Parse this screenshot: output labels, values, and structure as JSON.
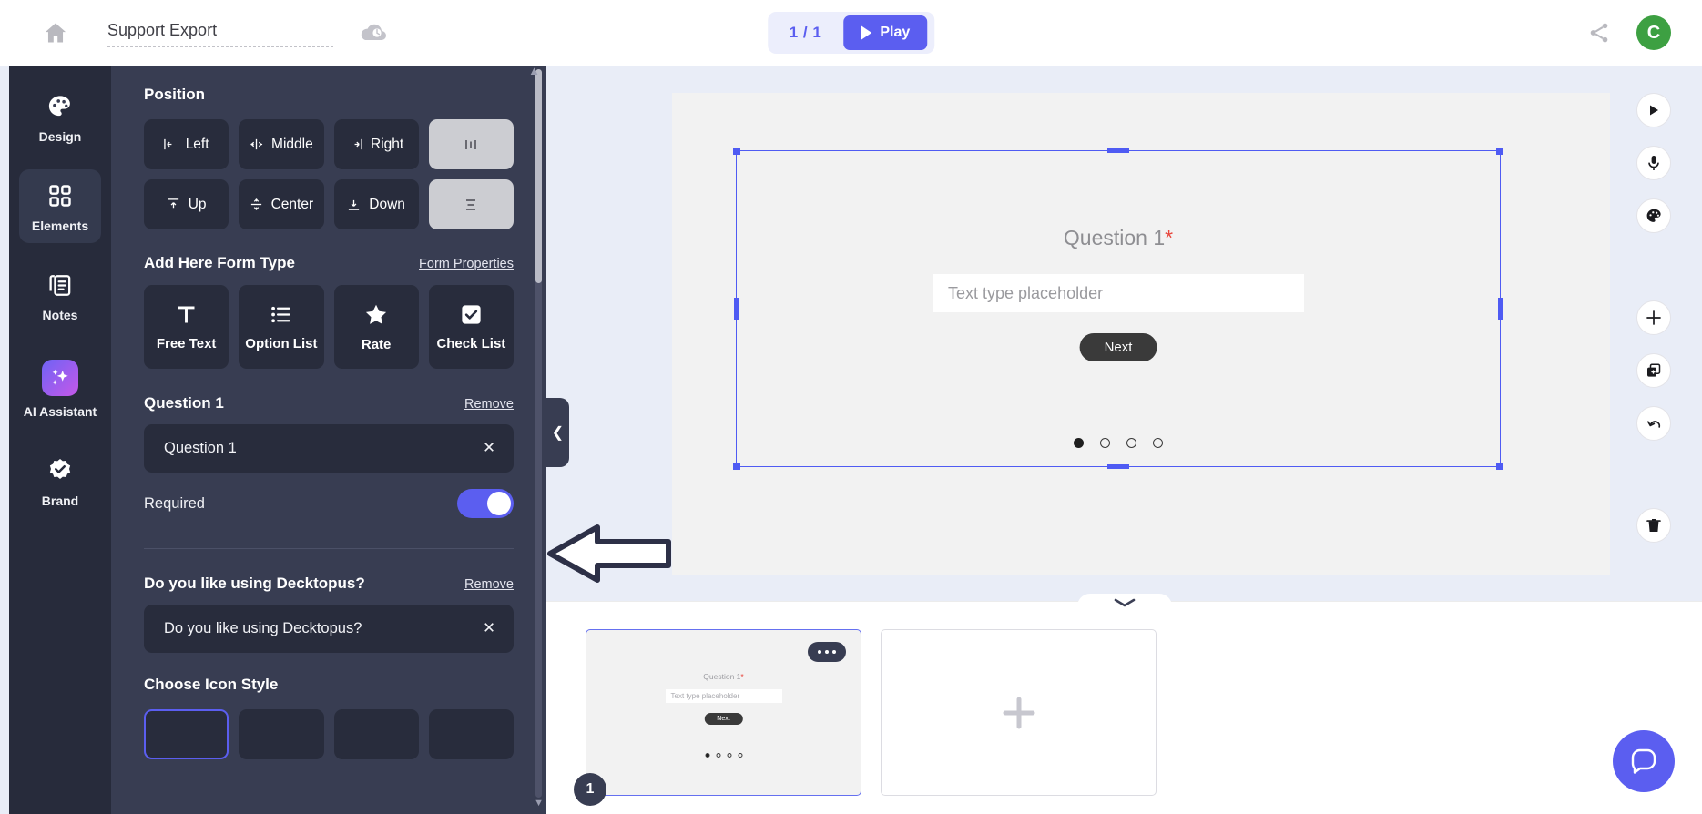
{
  "topbar": {
    "home_icon": "home-icon",
    "doc_title": "Support Export",
    "doc_title_placeholder": "Untitled",
    "cloud_icon": "cloud-clock-icon",
    "page_count": "1 / 1",
    "play_label": "Play",
    "share_icon": "share-icon",
    "avatar_initial": "C"
  },
  "rail": {
    "items": [
      {
        "label": "Design",
        "icon": "palette-icon",
        "active": false
      },
      {
        "label": "Elements",
        "icon": "grid-icon",
        "active": true
      },
      {
        "label": "Notes",
        "icon": "notes-icon",
        "active": false
      },
      {
        "label": "AI Assistant",
        "icon": "sparkle-icon",
        "active": false
      },
      {
        "label": "Brand",
        "icon": "badge-check-icon",
        "active": false
      }
    ]
  },
  "panel": {
    "position": {
      "title": "Position",
      "buttons": [
        {
          "label": "Left",
          "icon": "align-left-icon"
        },
        {
          "label": "Middle",
          "icon": "align-center-horizontal-icon"
        },
        {
          "label": "Right",
          "icon": "align-right-icon"
        },
        {
          "label": "",
          "icon": "distribute-horizontal-icon"
        },
        {
          "label": "Up",
          "icon": "align-top-icon"
        },
        {
          "label": "Center",
          "icon": "align-center-vertical-icon"
        },
        {
          "label": "Down",
          "icon": "align-bottom-icon"
        },
        {
          "label": "",
          "icon": "distribute-vertical-icon"
        }
      ]
    },
    "form_type": {
      "title": "Add Here Form Type",
      "properties_link": "Form Properties",
      "buttons": [
        {
          "label": "Free Text",
          "icon": "text-t-icon"
        },
        {
          "label": "Option List",
          "icon": "bullet-list-icon"
        },
        {
          "label": "Rate",
          "icon": "star-icon"
        },
        {
          "label": "Check List",
          "icon": "checkbox-icon"
        }
      ]
    },
    "question_1": {
      "title": "Question 1",
      "remove_label": "Remove",
      "input_value": "Question 1",
      "clear_icon": "close-icon",
      "required_label": "Required",
      "required_on": true
    },
    "question_2": {
      "title": "Do you like using Decktopus?",
      "remove_label": "Remove",
      "input_value": "Do you like using Decktopus?",
      "clear_icon": "close-icon"
    },
    "icon_style": {
      "title": "Choose Icon Style",
      "options": [
        "style-1",
        "style-2",
        "style-3",
        "style-4"
      ],
      "selected_index": 0
    },
    "collapse_chevron": "chevron-left-icon"
  },
  "canvas": {
    "question_label": "Question 1",
    "required_star": "*",
    "input_placeholder": "Text type placeholder",
    "next_label": "Next",
    "dots_total": 4,
    "dots_active_index": 0,
    "collapse_chevron": "chevron-down-icon",
    "tools": [
      {
        "icon": "play-icon",
        "name": "preview-slide"
      },
      {
        "icon": "microphone-icon",
        "name": "record-voice"
      },
      {
        "icon": "palette-icon",
        "name": "slide-theme"
      },
      {
        "icon": "plus-icon",
        "name": "add-slide"
      },
      {
        "icon": "duplicate-icon",
        "name": "duplicate-slide"
      },
      {
        "icon": "undo-icon",
        "name": "undo"
      },
      {
        "icon": "trash-icon",
        "name": "delete-slide"
      }
    ]
  },
  "filmstrip": {
    "slides": [
      {
        "number": "1",
        "question_label": "Question 1",
        "required_star": "*",
        "input_placeholder": "Text type placeholder",
        "next_label": "Next",
        "menu_icon": "ellipsis-icon",
        "selected": true
      }
    ],
    "add_slide_icon": "plus-icon"
  },
  "chat": {
    "icon": "chat-bubble-icon"
  },
  "annotation": {
    "arrow": "left-arrow-annotation"
  },
  "colors": {
    "accent": "#5b5ef0",
    "panel_bg": "#383d52",
    "rail_bg": "#272b3b",
    "stage_bg": "#e9edf7",
    "avatar_green": "#3da042",
    "required_red": "#e8453c"
  }
}
